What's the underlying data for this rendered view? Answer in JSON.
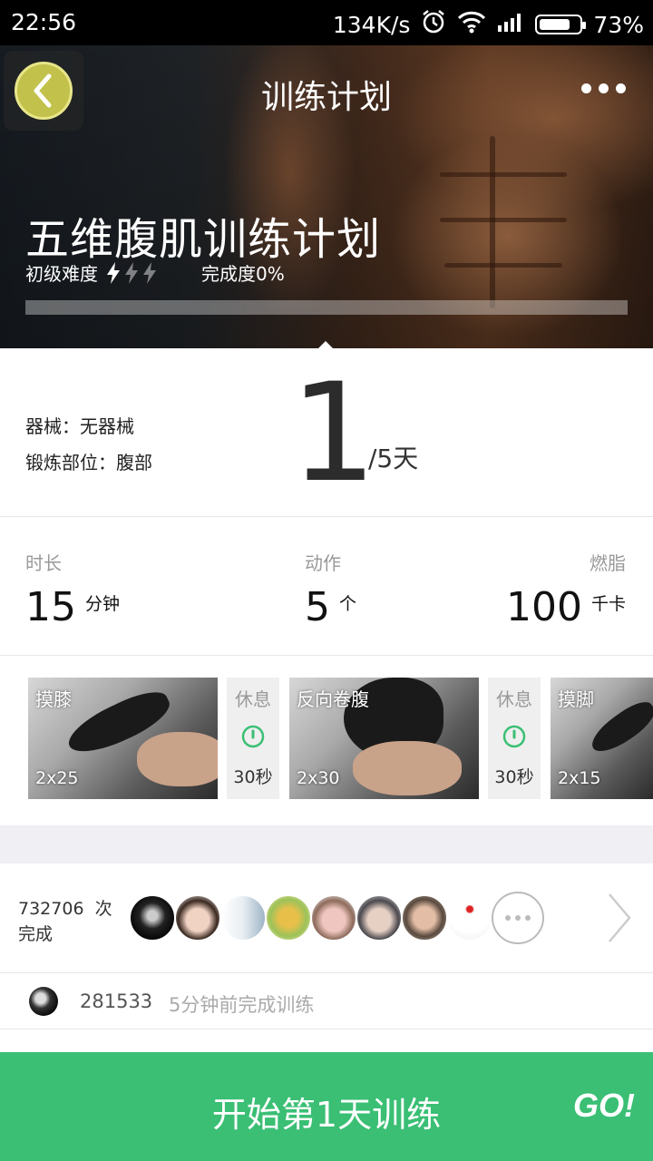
{
  "status_bar": {
    "time": "22:56",
    "network_speed": "134K/s",
    "battery": "73%",
    "battery_level": 0.73
  },
  "header": {
    "title": "训练计划"
  },
  "hero": {
    "plan_name": "五维腹肌训练计划",
    "difficulty": "初级难度",
    "difficulty_bolts_filled": 1,
    "difficulty_bolts_total": 3,
    "completion": "完成度0%",
    "progress": 0
  },
  "info": {
    "equipment": "器械：无器械",
    "body_part": "锻炼部位：腹部",
    "current_day": "1",
    "total_days": "/5天"
  },
  "stats": {
    "duration_label": "时长",
    "duration_value": "15",
    "duration_unit": "分钟",
    "actions_label": "动作",
    "actions_value": "5",
    "actions_unit": "个",
    "burn_label": "燃脂",
    "burn_value": "100",
    "burn_unit": "千卡"
  },
  "exercises": [
    {
      "name": "摸膝",
      "reps": "2x25"
    },
    {
      "rest_label": "休息",
      "rest_time": "30秒"
    },
    {
      "name": "反向卷腹",
      "reps": "2x30"
    },
    {
      "rest_label": "休息",
      "rest_time": "30秒"
    },
    {
      "name": "摸脚",
      "reps": "2x15"
    }
  ],
  "completions": {
    "count": "732706",
    "count_suffix": "次",
    "label": "完成"
  },
  "recent": {
    "user": "281533",
    "text": "5分钟前完成训练"
  },
  "start": {
    "label": "开始第1天训练",
    "go": "GO!"
  },
  "colors": {
    "accent_green": "#3abf74",
    "back_button": "#c2c14b"
  }
}
